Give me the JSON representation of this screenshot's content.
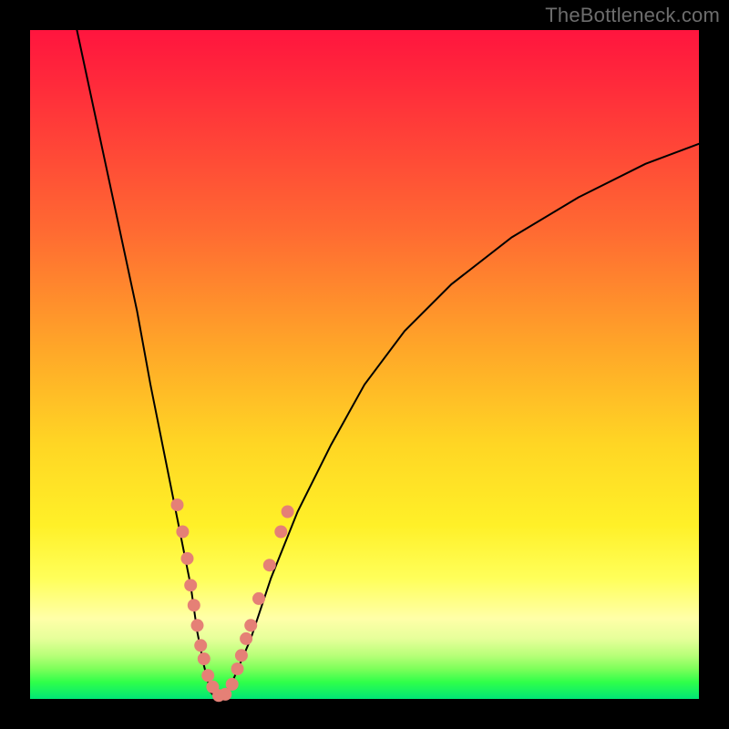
{
  "watermark": "TheBottleneck.com",
  "chart_data": {
    "type": "line",
    "title": "",
    "xlabel": "",
    "ylabel": "",
    "xlim": [
      0,
      100
    ],
    "ylim": [
      0,
      100
    ],
    "grid": false,
    "legend": false,
    "series": [
      {
        "name": "bottleneck-curve",
        "x": [
          7,
          10,
          13,
          16,
          18,
          20,
          22,
          24,
          25,
          26,
          27,
          28,
          30,
          33,
          36,
          40,
          45,
          50,
          56,
          63,
          72,
          82,
          92,
          100
        ],
        "y": [
          100,
          86,
          72,
          58,
          47,
          37,
          27,
          17,
          10,
          5,
          1,
          0,
          2,
          9,
          18,
          28,
          38,
          47,
          55,
          62,
          69,
          75,
          80,
          83
        ],
        "stroke": "#000000",
        "stroke_width": 2
      }
    ],
    "markers": {
      "name": "sample-dots",
      "color": "#e58076",
      "radius_px": 7,
      "points": [
        {
          "x": 22.0,
          "y": 29
        },
        {
          "x": 22.8,
          "y": 25
        },
        {
          "x": 23.5,
          "y": 21
        },
        {
          "x": 24.0,
          "y": 17
        },
        {
          "x": 24.5,
          "y": 14
        },
        {
          "x": 25.0,
          "y": 11
        },
        {
          "x": 25.5,
          "y": 8
        },
        {
          "x": 26.0,
          "y": 6
        },
        {
          "x": 26.6,
          "y": 3.5
        },
        {
          "x": 27.3,
          "y": 1.8
        },
        {
          "x": 28.2,
          "y": 0.5
        },
        {
          "x": 29.2,
          "y": 0.7
        },
        {
          "x": 30.2,
          "y": 2.2
        },
        {
          "x": 31.0,
          "y": 4.5
        },
        {
          "x": 31.6,
          "y": 6.5
        },
        {
          "x": 32.3,
          "y": 9
        },
        {
          "x": 33.0,
          "y": 11
        },
        {
          "x": 34.2,
          "y": 15
        },
        {
          "x": 35.8,
          "y": 20
        },
        {
          "x": 37.5,
          "y": 25
        },
        {
          "x": 38.5,
          "y": 28
        }
      ]
    },
    "background_gradient": {
      "direction": "top-to-bottom",
      "stops": [
        {
          "pos": 0.0,
          "color": "#ff153e"
        },
        {
          "pos": 0.3,
          "color": "#ff6a32"
        },
        {
          "pos": 0.62,
          "color": "#ffd624"
        },
        {
          "pos": 0.88,
          "color": "#ffffa8"
        },
        {
          "pos": 1.0,
          "color": "#00e676"
        }
      ]
    }
  }
}
